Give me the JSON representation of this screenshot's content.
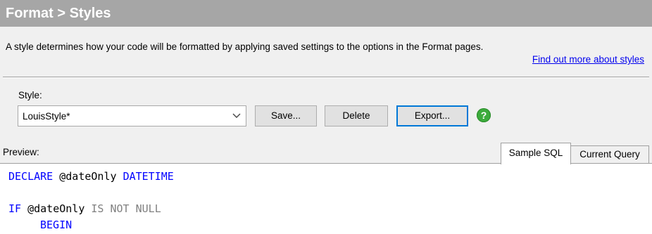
{
  "title": "Format > Styles",
  "description": "A style determines how your code will be formatted by applying saved settings to the options in the Format pages.",
  "help_link": "Find out more about styles",
  "style_label": "Style:",
  "style_select": {
    "value": "LouisStyle*",
    "icon": "chevron-down-icon"
  },
  "buttons": {
    "save": "Save...",
    "delete": "Delete",
    "export": "Export..."
  },
  "help_icon": {
    "glyph": "?",
    "icon": "help-icon",
    "color": "#3cab3c"
  },
  "preview_label": "Preview:",
  "tabs": [
    {
      "label": "Sample SQL",
      "active": true
    },
    {
      "label": "Current Query",
      "active": false
    }
  ],
  "code": {
    "line1": {
      "kw1": "DECLARE",
      "var": "@dateOnly",
      "kw2": "DATETIME"
    },
    "line2": {
      "kw1": "IF",
      "var": "@dateOnly",
      "op": "IS NOT NULL"
    },
    "line3": {
      "kw1": "BEGIN"
    }
  },
  "colors": {
    "title_bar": "#a6a6a6",
    "keyword": "#0000ff",
    "operator": "#808080",
    "link": "#0000ee",
    "focus_border": "#0078d7"
  }
}
